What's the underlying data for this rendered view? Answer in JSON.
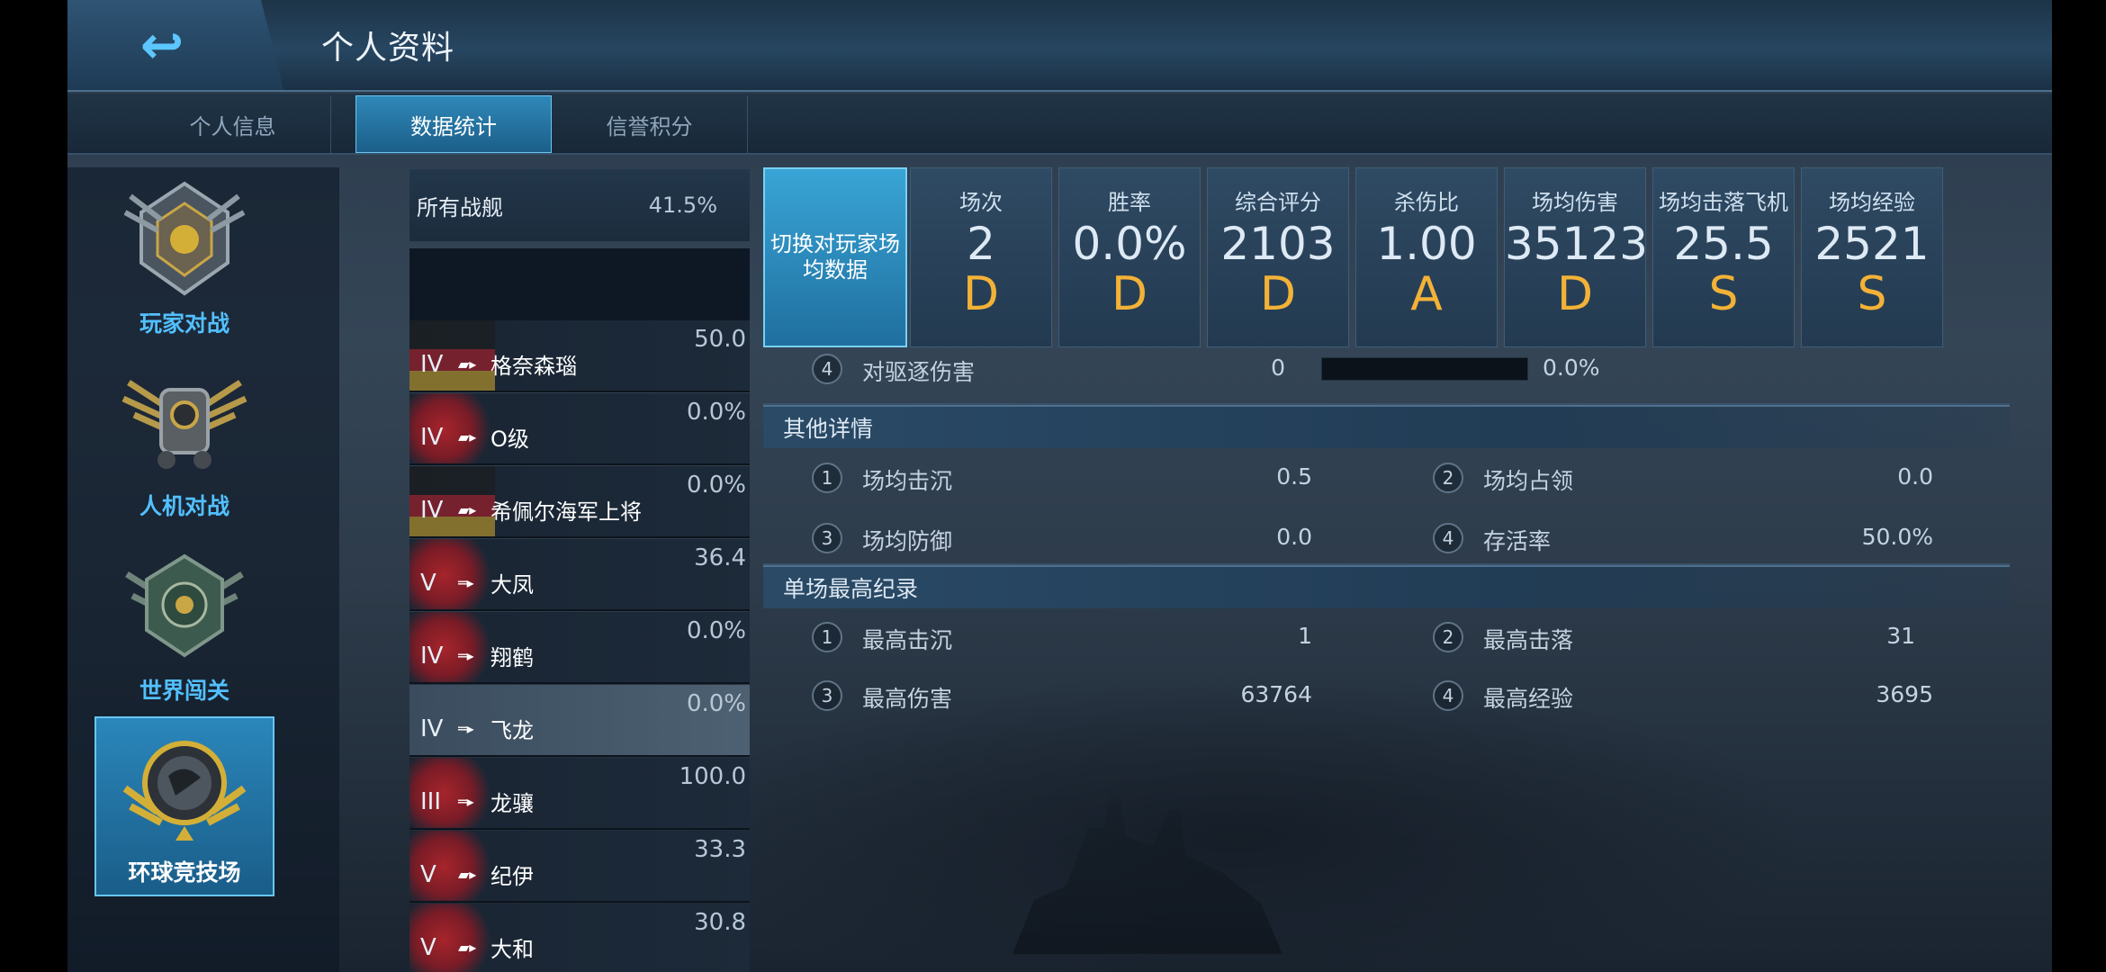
{
  "header": {
    "title": "个人资料",
    "back_icon": "back-arrow-icon"
  },
  "tabs": [
    {
      "label": "个人信息",
      "active": false
    },
    {
      "label": "数据统计",
      "active": true
    },
    {
      "label": "信誉积分",
      "active": false
    }
  ],
  "modes": [
    {
      "label": "玩家对战",
      "icon": "pvp-emblem-icon",
      "active": false
    },
    {
      "label": "人机对战",
      "icon": "pve-emblem-icon",
      "active": false
    },
    {
      "label": "世界闯关",
      "icon": "world-emblem-icon",
      "active": false
    },
    {
      "label": "环球竞技场",
      "icon": "arena-emblem-icon",
      "active": true
    }
  ],
  "ships": {
    "all_label": "所有战舰",
    "all_value": "41.5%",
    "items": [
      {
        "tier": "IV",
        "name": "格奈森瑙",
        "value": "50.0",
        "selected": false
      },
      {
        "tier": "IV",
        "name": "O级",
        "value": "0.0%",
        "selected": false
      },
      {
        "tier": "IV",
        "name": "希佩尔海军上将",
        "value": "0.0%",
        "selected": false
      },
      {
        "tier": "V",
        "name": "大凤",
        "value": "36.4",
        "selected": false
      },
      {
        "tier": "IV",
        "name": "翔鹤",
        "value": "0.0%",
        "selected": false
      },
      {
        "tier": "IV",
        "name": "飞龙",
        "value": "0.0%",
        "selected": true
      },
      {
        "tier": "III",
        "name": "龙骧",
        "value": "100.0",
        "selected": false
      },
      {
        "tier": "V",
        "name": "纪伊",
        "value": "33.3",
        "selected": false
      },
      {
        "tier": "V",
        "name": "大和",
        "value": "30.8",
        "selected": false
      }
    ]
  },
  "switch_label": "切换对玩家场均数据",
  "stats": [
    {
      "label": "场次",
      "value": "2",
      "grade": "D"
    },
    {
      "label": "胜率",
      "value": "0.0%",
      "grade": "D"
    },
    {
      "label": "综合评分",
      "value": "2103",
      "grade": "D"
    },
    {
      "label": "杀伤比",
      "value": "1.00",
      "grade": "A"
    },
    {
      "label": "场均伤害",
      "value": "35123",
      "grade": "D"
    },
    {
      "label": "场均击落飞机",
      "value": "25.5",
      "grade": "S"
    },
    {
      "label": "场均经验",
      "value": "2521",
      "grade": "S"
    }
  ],
  "partial_row": {
    "num": "4",
    "label": "对驱逐伤害",
    "value": "0",
    "pct": "0.0%",
    "bar_fraction": 0
  },
  "other": {
    "title": "其他详情",
    "items": [
      {
        "num": "1",
        "label": "场均击沉",
        "value": "0.5"
      },
      {
        "num": "2",
        "label": "场均占领",
        "value": "0.0"
      },
      {
        "num": "3",
        "label": "场均防御",
        "value": "0.0"
      },
      {
        "num": "4",
        "label": "存活率",
        "value": "50.0%"
      }
    ]
  },
  "best": {
    "title": "单场最高纪录",
    "items": [
      {
        "num": "1",
        "label": "最高击沉",
        "value": "1"
      },
      {
        "num": "2",
        "label": "最高击落",
        "value": "31"
      },
      {
        "num": "3",
        "label": "最高伤害",
        "value": "63764"
      },
      {
        "num": "4",
        "label": "最高经验",
        "value": "3695"
      }
    ]
  },
  "colors": {
    "accent": "#52c0ff",
    "grade": "#f3b237",
    "active_tab": "#2f88b8"
  }
}
